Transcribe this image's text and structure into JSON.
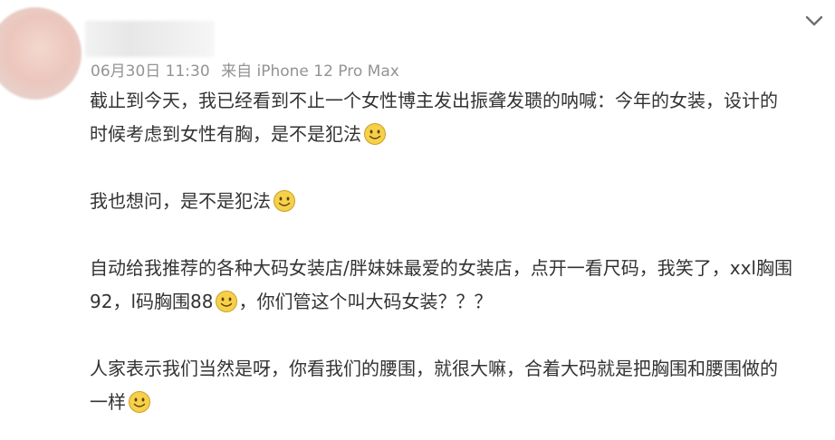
{
  "post": {
    "meta": {
      "date": "06月30日 11:30",
      "source": "来自 iPhone 12 Pro Max"
    },
    "paragraphs": [
      {
        "lines": [
          "截止到今天，我已经看到不止一个女性博主发出振聋发聩的呐喊：今年的女装，设计的",
          "时候考虑到女性有胸，是不是犯法"
        ]
      },
      {
        "lines": [
          "我也想问，是不是犯法"
        ]
      },
      {
        "lines": [
          "自动给我推荐的各种大码女装店/胖妹妹最爱的女装店，点开一看尺码，我笑了，xxl胸围",
          "92，l码胸围88",
          "，你们管这个叫大码女装？？？"
        ]
      },
      {
        "lines": [
          "人家表示我们当然是呀，你看我们的腰围，就很大嘛，合着大码就是把胸围和腰围做的",
          "一样"
        ]
      }
    ],
    "icons": {
      "emoji": "smile-emoji-icon",
      "collapse": "chevron-down-icon"
    }
  },
  "colors": {
    "text": "#333333",
    "meta": "#939393",
    "emoji_face": "#f7d04a"
  }
}
